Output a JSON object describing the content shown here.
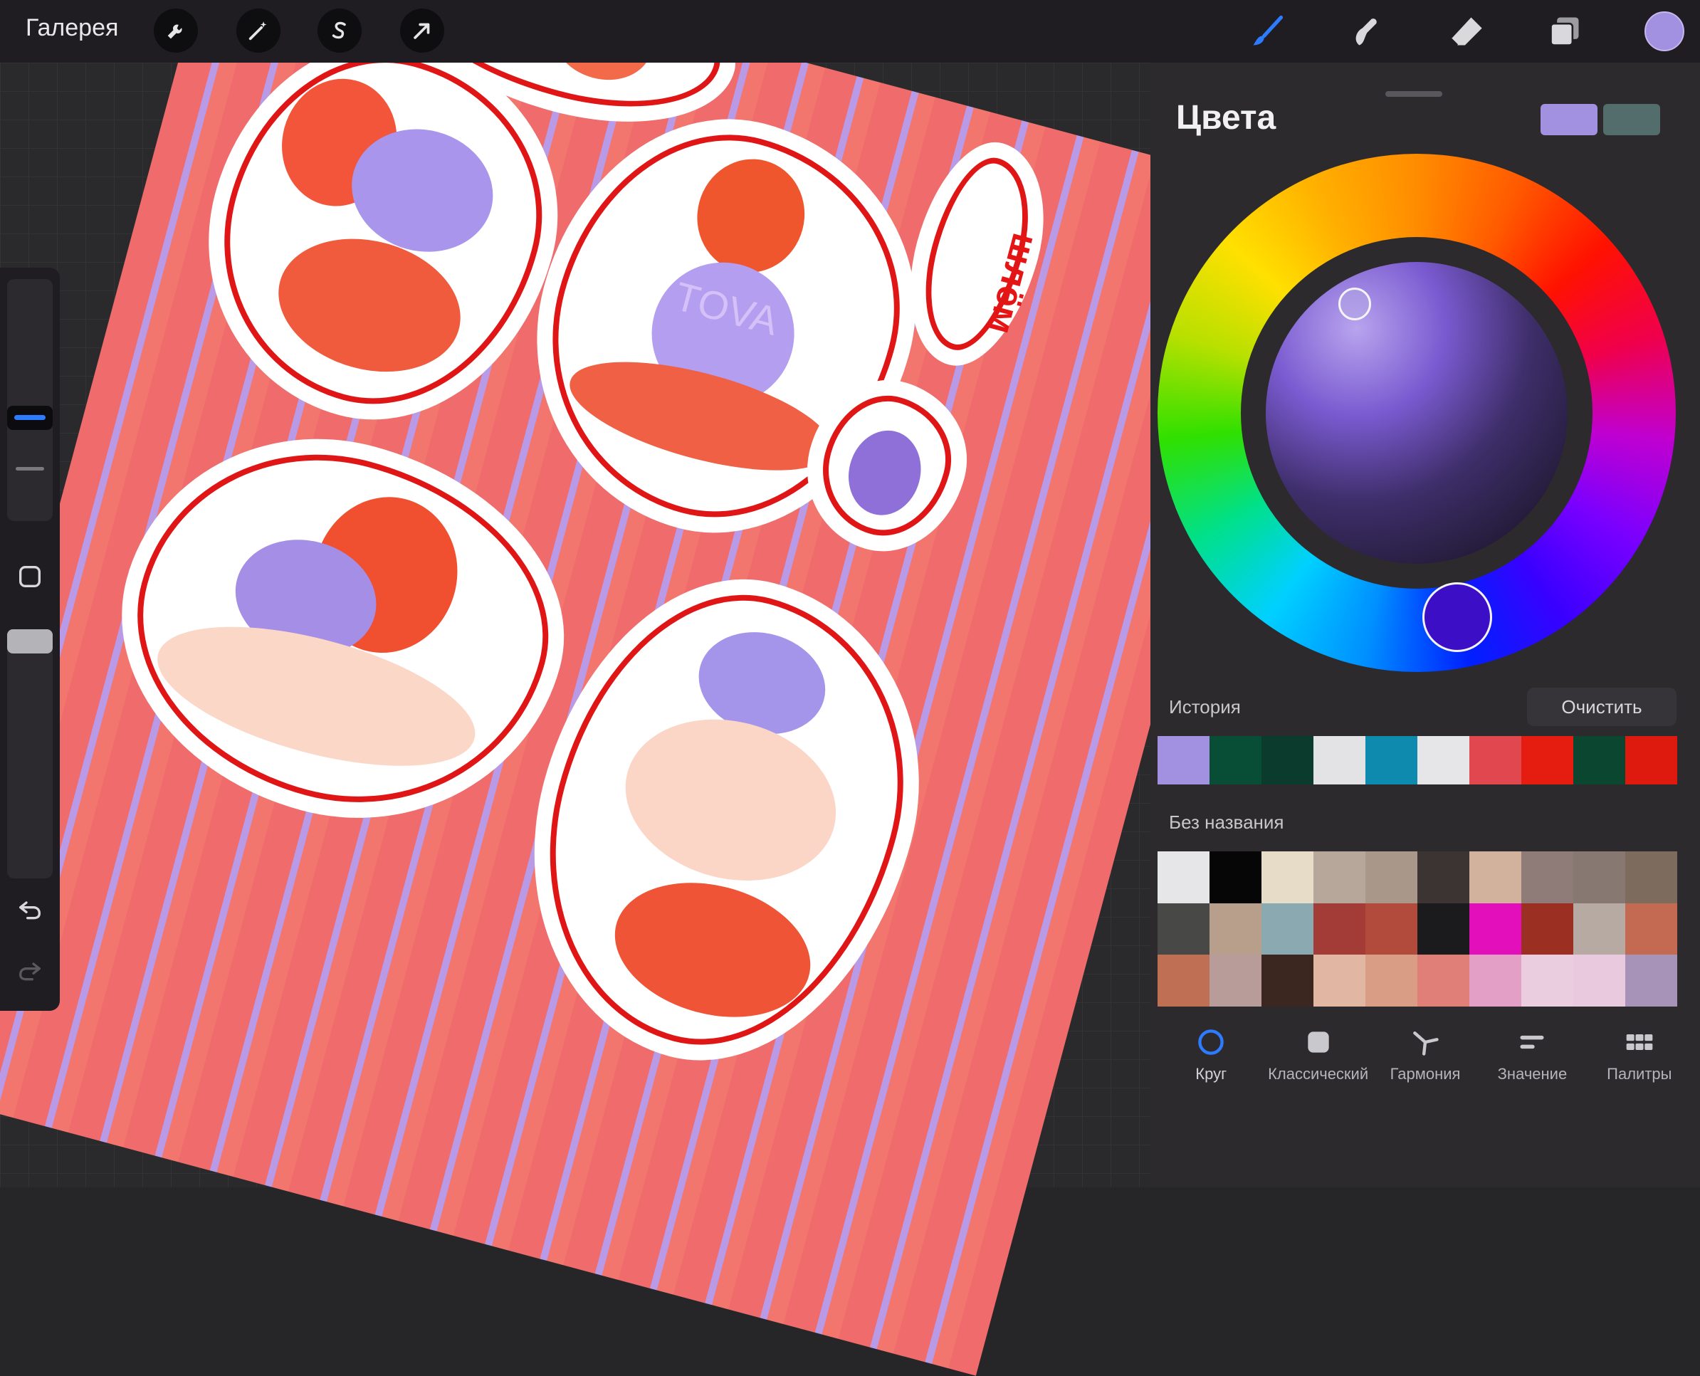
{
  "topbar": {
    "gallery_label": "Галерея",
    "tools_left": [
      "wrench-icon",
      "magic-wand-icon",
      "selection-s-icon",
      "transform-arrow-icon"
    ],
    "tools_right": [
      "brush-icon",
      "smudge-icon",
      "eraser-icon",
      "layers-icon"
    ],
    "current_color": "#a291e0",
    "active_tool_color": "#2d7cff"
  },
  "canvas": {
    "artwork_text": "шлём",
    "watermark": "TOVA"
  },
  "panel": {
    "title": "Цвета",
    "primary_color": "#a291e0",
    "secondary_color": "#536c6c",
    "history_label": "История",
    "clear_label": "Очистить",
    "history_colors": [
      "#a291e0",
      "#084d36",
      "#0b3b2c",
      "#e3e3e5",
      "#0d8aae",
      "#e6e6e8",
      "#e0474f",
      "#e51d10",
      "#0a4630",
      "#de1a0e"
    ],
    "palette_label": "Без названия",
    "palette_colors": [
      "#e6e6e8",
      "#060606",
      "#e7dcc8",
      "#b6a79a",
      "#a9988a",
      "#3c3433",
      "#d3b29d",
      "#8f7b77",
      "#877872",
      "#7d6b5d",
      "#484847",
      "#b89f8c",
      "#8ba9b0",
      "#a33b37",
      "#b34b3c",
      "#1b1b1d",
      "#e20fbb",
      "#9b3022",
      "#b7aaa3",
      "#c46a52",
      "#be6f54",
      "#b79c9a",
      "#3c2620",
      "#e1b6a2",
      "#d99c85",
      "#e07f77",
      "#e49fc6",
      "#ebcde0",
      "#e9c9dd",
      "#a893b8"
    ],
    "tabs": [
      {
        "label": "Круг",
        "icon": "circle-icon"
      },
      {
        "label": "Классический",
        "icon": "square-icon"
      },
      {
        "label": "Гармония",
        "icon": "harmony-icon"
      },
      {
        "label": "Значение",
        "icon": "value-sliders-icon"
      },
      {
        "label": "Палитры",
        "icon": "palettes-grid-icon"
      }
    ]
  }
}
